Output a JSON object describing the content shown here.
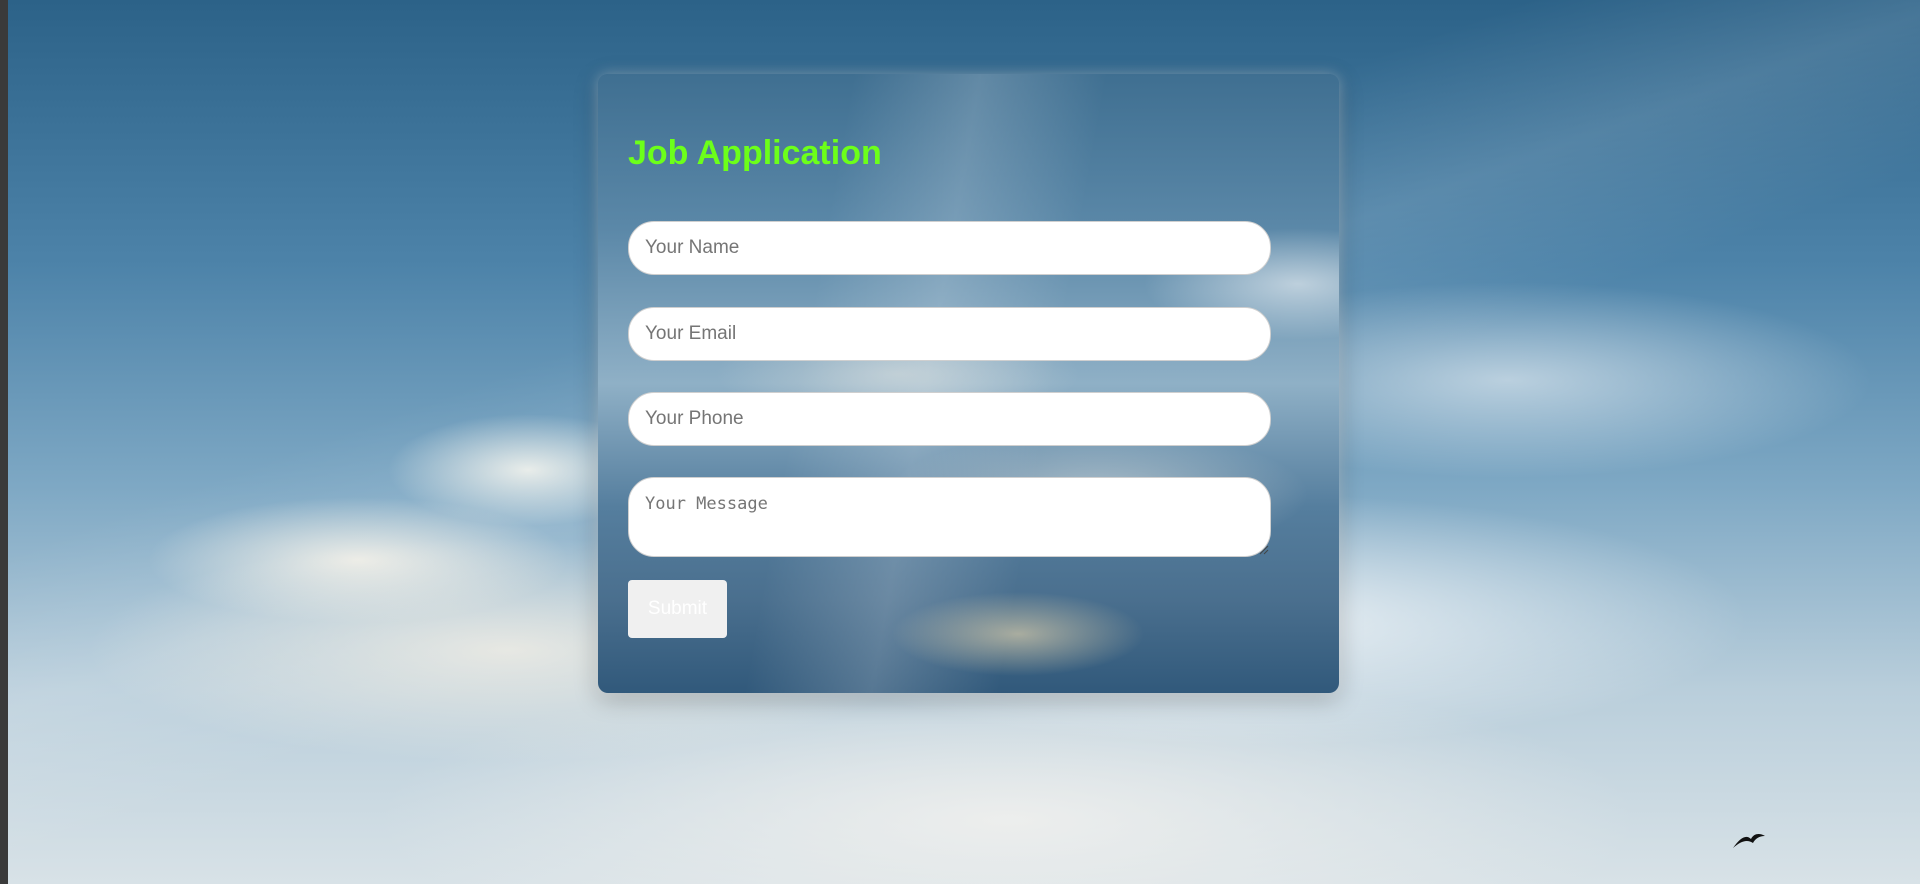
{
  "form": {
    "title": "Job Application",
    "name_placeholder": "Your Name",
    "email_placeholder": "Your Email",
    "phone_placeholder": "Your Phone",
    "message_placeholder": "Your Message",
    "submit_label": "Submit"
  },
  "colors": {
    "title": "#6cff1a",
    "field_background": "#ffffff",
    "submit_background": "#f0f0f0",
    "submit_text": "#ffffff"
  },
  "icons": {
    "background_bird": "bird-icon",
    "textarea_grip": "resize-grip-icon"
  }
}
